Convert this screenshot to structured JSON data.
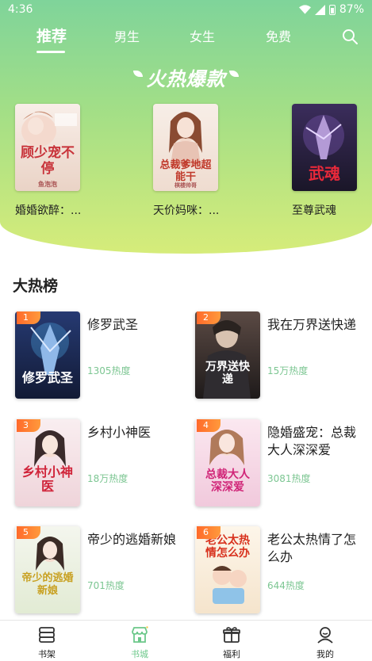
{
  "status": {
    "time": "4:36",
    "battery": "87%"
  },
  "tabs": [
    {
      "label": "推荐",
      "active": true
    },
    {
      "label": "男生",
      "active": false
    },
    {
      "label": "女生",
      "active": false
    },
    {
      "label": "免费",
      "active": false
    }
  ],
  "hot_section": {
    "title": "火热爆款",
    "books": [
      {
        "name": "婚婚欲醉：...",
        "cover_text": "顾少宠不停",
        "cover_author": "鱼泡泡",
        "cover_color": "#f3e6de"
      },
      {
        "name": "天价妈咪：...",
        "cover_text": "总裁爹地超能干",
        "cover_author": "棋楼帅哥",
        "cover_color": "#f1e7df"
      },
      {
        "name": "至尊武魂",
        "cover_text": "武魂",
        "cover_author": "",
        "cover_color": "#2b2140"
      }
    ]
  },
  "rank_section": {
    "title": "大热榜",
    "items": [
      {
        "rank": "1",
        "title": "修罗武圣",
        "heat": "1305热度",
        "cover_text": "修罗武圣",
        "cover_color": "#22305a"
      },
      {
        "rank": "2",
        "title": "我在万界送快递",
        "heat": "15万热度",
        "cover_text": "万界送快递",
        "cover_color": "#3b3030"
      },
      {
        "rank": "3",
        "title": "乡村小神医",
        "heat": "18万热度",
        "cover_text": "乡村小神医",
        "cover_color": "#f4dfe4"
      },
      {
        "rank": "4",
        "title": "隐婚盛宠：总裁大人深深爱",
        "heat": "3081热度",
        "cover_text": "总裁大人深深爱",
        "cover_color": "#f6dce8"
      },
      {
        "rank": "5",
        "title": "帝少的逃婚新娘",
        "heat": "701热度",
        "cover_text": "帝少的逃婚新娘",
        "cover_color": "#eef3e6"
      },
      {
        "rank": "6",
        "title": "老公太热情了怎么办",
        "heat": "644热度",
        "cover_text": "老公太热情怎么办",
        "cover_color": "#fbf1e2"
      }
    ]
  },
  "bottom_nav": [
    {
      "label": "书架",
      "icon": "bookshelf-icon",
      "active": false
    },
    {
      "label": "书城",
      "icon": "bookstore-icon",
      "active": true
    },
    {
      "label": "福利",
      "icon": "gift-icon",
      "active": false
    },
    {
      "label": "我的",
      "icon": "profile-icon",
      "active": false
    }
  ],
  "colors": {
    "accent": "#6cc88a",
    "heat_text": "#7cc692",
    "rank_badge": "#ff7a30"
  }
}
